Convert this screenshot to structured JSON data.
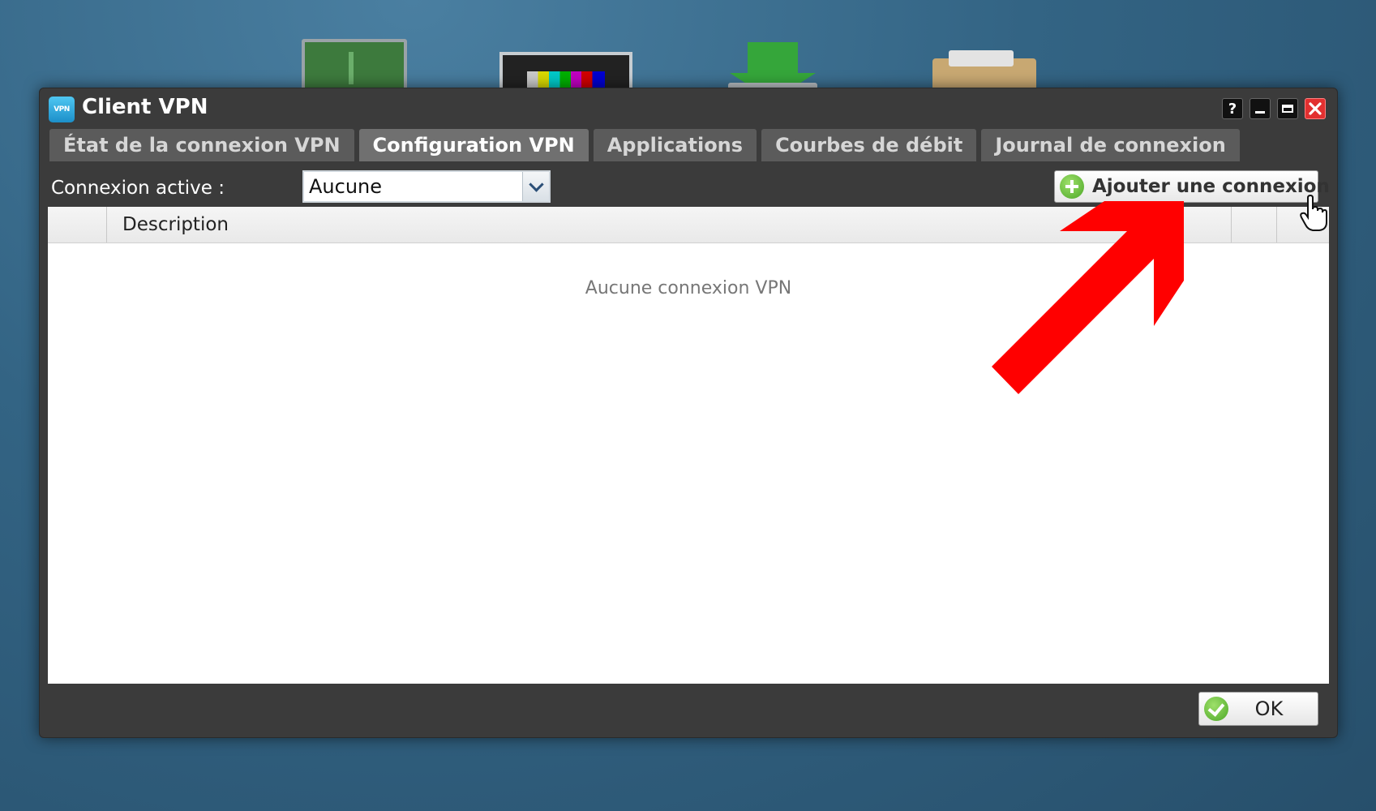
{
  "window": {
    "title": "Client VPN",
    "app_icon_text": "VPN",
    "controls": {
      "help": "?"
    }
  },
  "tabs": [
    {
      "label": "État de la connexion VPN",
      "active": false
    },
    {
      "label": "Configuration VPN",
      "active": true
    },
    {
      "label": "Applications",
      "active": false
    },
    {
      "label": "Courbes de débit",
      "active": false
    },
    {
      "label": "Journal de connexion",
      "active": false
    }
  ],
  "toolbar": {
    "active_connection_label": "Connexion active :",
    "active_connection_value": "Aucune",
    "add_button_label": "Ajouter une connexion"
  },
  "table": {
    "columns": [
      "Description"
    ],
    "empty_message": "Aucune connexion VPN"
  },
  "footer": {
    "ok_label": "OK"
  },
  "colors": {
    "annotation_arrow": "#ff0000",
    "window_bg": "#3b3b3b",
    "active_tab": "#707070",
    "inactive_tab": "#5b5b5b"
  }
}
